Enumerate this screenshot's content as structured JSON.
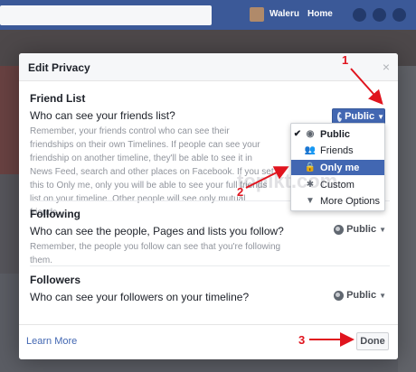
{
  "topbar": {
    "name": "Waleru",
    "home": "Home"
  },
  "dialog": {
    "title": "Edit Privacy",
    "close_icon": "×",
    "sections": [
      {
        "title": "Friend List",
        "question": "Who can see your friends list?",
        "description": "Remember, your friends control who can see their friendships on their own Timelines. If people can see your friendship on another timeline, they'll be able to see it in News Feed, search and other places on Facebook. If you set this to Only me, only you will be able to see your full friends list on your timeline. Other people will see only mutual friends.",
        "selector": "Public"
      },
      {
        "title": "Following",
        "question": "Who can see the people, Pages and lists you follow?",
        "description": "Remember, the people you follow can see that you're following them.",
        "selector": "Public"
      },
      {
        "title": "Followers",
        "question": "Who can see your followers on your timeline?",
        "selector": "Public"
      }
    ],
    "menu": {
      "items": [
        {
          "label": "Public",
          "icon": "globe-icon",
          "checked": true
        },
        {
          "label": "Friends",
          "icon": "friends-icon"
        },
        {
          "label": "Only me",
          "icon": "lock-icon",
          "highlighted": true
        },
        {
          "label": "Custom",
          "icon": "gear-icon"
        },
        {
          "label": "More Options",
          "icon": "triangle-down-icon"
        }
      ]
    },
    "footer": {
      "learn_more": "Learn More",
      "done": "Done"
    }
  },
  "annotations": {
    "one": "1",
    "two": "2",
    "three": "3"
  },
  "watermark": "topikt.com",
  "colors": {
    "brand": "#3b5998",
    "accent": "#4267b2",
    "annotation": "#e0141e"
  }
}
